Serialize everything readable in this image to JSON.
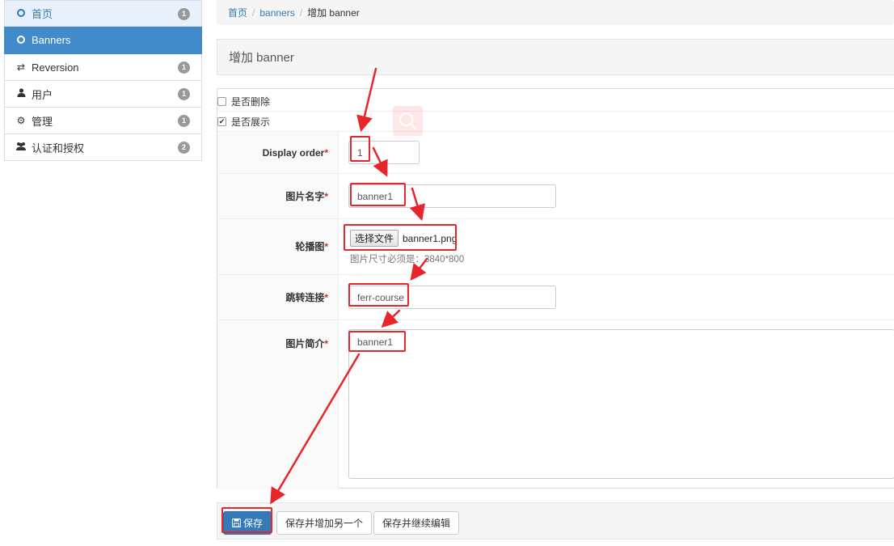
{
  "sidebar": {
    "items": [
      {
        "label": "首页",
        "icon": "circle-icon",
        "badge": "1",
        "active": false
      },
      {
        "label": "Banners",
        "icon": "circle-icon",
        "badge": "",
        "active": true
      },
      {
        "label": "Reversion",
        "icon": "exchange-icon",
        "badge": "1",
        "active": false
      },
      {
        "label": "用户",
        "icon": "user-icon",
        "badge": "1",
        "active": false
      },
      {
        "label": "管理",
        "icon": "gear-icon",
        "badge": "1",
        "active": false
      },
      {
        "label": "认证和授权",
        "icon": "group-icon",
        "badge": "2",
        "active": false
      }
    ]
  },
  "breadcrumb": {
    "home": "首页",
    "section": "banners",
    "current": "增加 banner"
  },
  "page_title": "增加 banner",
  "form": {
    "checkboxes": [
      {
        "label": "是否删除",
        "checked": false
      },
      {
        "label": "是否展示",
        "checked": true
      }
    ],
    "fields": {
      "display_order": {
        "label": "Display order",
        "value": "1"
      },
      "image_name": {
        "label": "图片名字",
        "value": "banner1"
      },
      "carousel": {
        "label": "轮播图",
        "button_label": "选择文件",
        "file_name": "banner1.png",
        "help": "图片尺寸必须是：3840*800"
      },
      "link": {
        "label": "跳转连接",
        "value": "ferr-course"
      },
      "description": {
        "label": "图片简介",
        "value": "banner1"
      }
    },
    "required_mark": "*"
  },
  "actions": {
    "save": "保存",
    "save_add_another": "保存并增加另一个",
    "save_continue": "保存并继续编辑"
  },
  "colors": {
    "primary": "#337ab7",
    "annotation": "#e8252a"
  }
}
